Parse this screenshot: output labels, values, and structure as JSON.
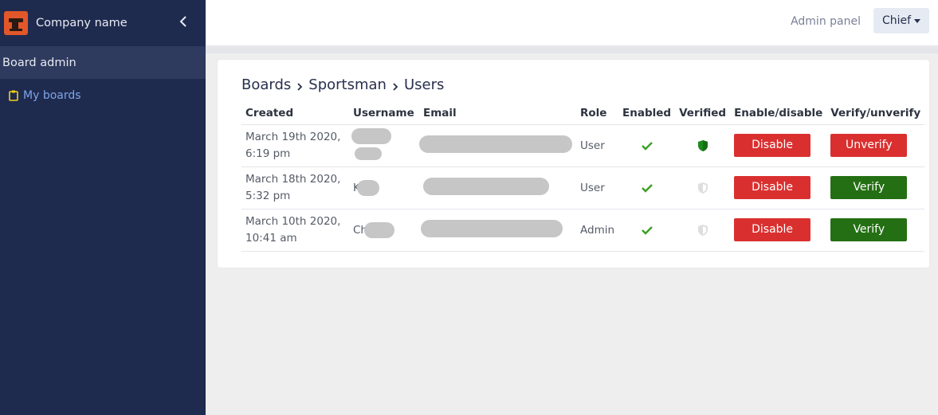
{
  "sidebar": {
    "brand": "Company name",
    "section": "Board admin",
    "items": [
      {
        "label": "My boards"
      }
    ]
  },
  "header": {
    "admin_panel": "Admin panel",
    "user": "Chief"
  },
  "breadcrumb": [
    "Boards",
    "Sportsman",
    "Users"
  ],
  "table": {
    "headers": [
      "Created",
      "Username",
      "Email",
      "Role",
      "Enabled",
      "Verified",
      "Enable/disable",
      "Verify/unverify"
    ],
    "rows": [
      {
        "created_line1": "March 19th 2020,",
        "created_line2": "6:19 pm",
        "username": "",
        "role": "User",
        "enabled": true,
        "verified": true,
        "toggle": "Disable",
        "verify": "Unverify"
      },
      {
        "created_line1": "March 18th 2020,",
        "created_line2": "5:32 pm",
        "username": "K",
        "role": "User",
        "enabled": true,
        "verified": false,
        "toggle": "Disable",
        "verify": "Verify"
      },
      {
        "created_line1": "March 10th 2020,",
        "created_line2": "10:41 am",
        "username": "Ch",
        "role": "Admin",
        "enabled": true,
        "verified": false,
        "toggle": "Disable",
        "verify": "Verify"
      }
    ]
  },
  "colors": {
    "sidebar": "#1f2a4f",
    "danger": "#d9302f",
    "success": "#246f13",
    "check": "#3aa022"
  },
  "icons": [
    "logo-icon",
    "chevron-left-icon",
    "clipboard-icon",
    "chevron-right-icon",
    "check-icon",
    "shield-icon",
    "caret-down-icon"
  ]
}
